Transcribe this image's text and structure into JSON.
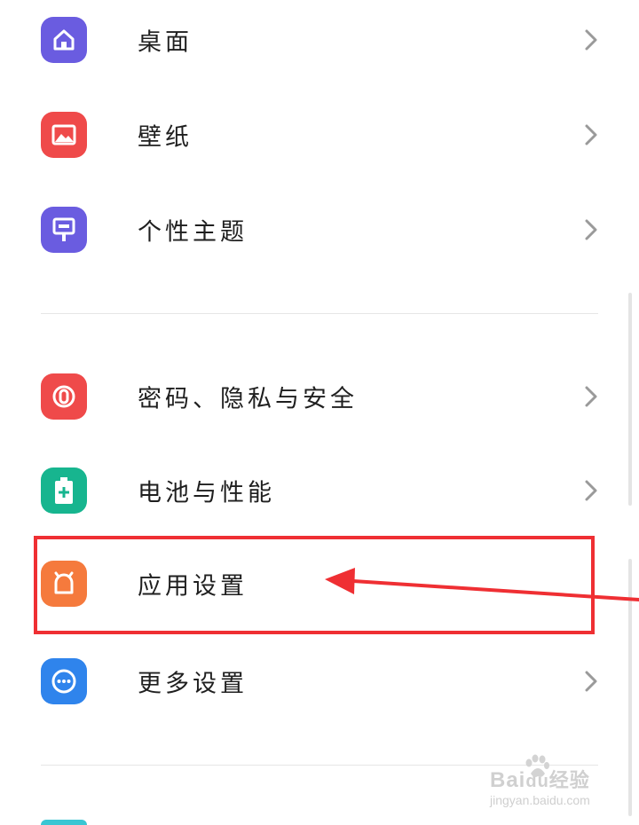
{
  "settings_groups": [
    {
      "items": [
        {
          "label": "桌面",
          "icon": "home-icon",
          "color": "#6a5ce0"
        },
        {
          "label": "壁纸",
          "icon": "picture-icon",
          "color": "#ef4a4a"
        },
        {
          "label": "个性主题",
          "icon": "theme-icon",
          "color": "#6a5ce0"
        }
      ]
    },
    {
      "items": [
        {
          "label": "密码、隐私与安全",
          "icon": "lock-icon",
          "color": "#ef4a4a"
        },
        {
          "label": "电池与性能",
          "icon": "battery-icon",
          "color": "#17b58f"
        },
        {
          "label": "应用设置",
          "icon": "app-icon",
          "color": "#f57a3d"
        },
        {
          "label": "更多设置",
          "icon": "more-icon",
          "color": "#2f84ec"
        }
      ]
    }
  ],
  "annotation": {
    "highlight_color": "#ef2f33",
    "target_item": "应用设置"
  },
  "watermark": {
    "brand_prefix": "Bai",
    "brand_suffix": "经验",
    "url": "jingyan.baidu.com"
  },
  "colors": {
    "chevron": "#9a9a9a",
    "divider": "#e6e6e6",
    "text": "#1f1f1f"
  }
}
